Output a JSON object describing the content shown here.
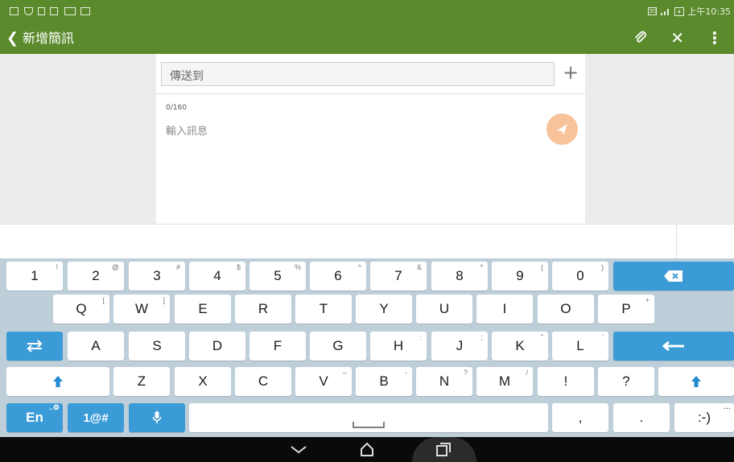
{
  "status_bar": {
    "time": "上午10:35",
    "network_badge": "3G",
    "signal_icon": "signal-bars-icon",
    "battery_icon": "battery-charging-icon",
    "left_icons": [
      "gallery-icon",
      "wifi-tray-icon",
      "document-icon",
      "file-edit-icon",
      "card-icon",
      "mail-icon"
    ]
  },
  "action_bar": {
    "back_glyph": "❮",
    "title": "新增簡訊",
    "attach_icon": "paperclip-icon",
    "discard_icon": "close-icon",
    "overflow_icon": "overflow-menu-icon",
    "attach_glyph": "🖇",
    "close_glyph": "✕",
    "more_glyph": "⋮"
  },
  "composer": {
    "to_placeholder": "傳送到",
    "add_glyph": "+",
    "char_counter": "0/160",
    "message_placeholder": "輸入訊息",
    "send_icon": "send-plane-icon",
    "send_color": "#f8c29a"
  },
  "keyboard": {
    "row1": [
      {
        "label": "1",
        "sub": "!"
      },
      {
        "label": "2",
        "sub": "@"
      },
      {
        "label": "3",
        "sub": "#"
      },
      {
        "label": "4",
        "sub": "$"
      },
      {
        "label": "5",
        "sub": "%"
      },
      {
        "label": "6",
        "sub": "^"
      },
      {
        "label": "7",
        "sub": "&"
      },
      {
        "label": "8",
        "sub": "*"
      },
      {
        "label": "9",
        "sub": "("
      },
      {
        "label": "0",
        "sub": ")"
      }
    ],
    "row2": [
      {
        "label": "Q",
        "sub": "["
      },
      {
        "label": "W",
        "sub": "]"
      },
      {
        "label": "E",
        "sub": ""
      },
      {
        "label": "R",
        "sub": ""
      },
      {
        "label": "T",
        "sub": ""
      },
      {
        "label": "Y",
        "sub": ""
      },
      {
        "label": "U",
        "sub": ""
      },
      {
        "label": "I",
        "sub": ""
      },
      {
        "label": "O",
        "sub": ""
      },
      {
        "label": "P",
        "sub": "+"
      }
    ],
    "row3": [
      {
        "label": "A",
        "sub": ""
      },
      {
        "label": "S",
        "sub": ""
      },
      {
        "label": "D",
        "sub": ""
      },
      {
        "label": "F",
        "sub": ""
      },
      {
        "label": "G",
        "sub": ""
      },
      {
        "label": "H",
        "sub": ":"
      },
      {
        "label": "J",
        "sub": ";"
      },
      {
        "label": "K",
        "sub": "\""
      },
      {
        "label": "L",
        "sub": "'"
      }
    ],
    "row4": [
      {
        "label": "Z",
        "sub": ""
      },
      {
        "label": "X",
        "sub": ""
      },
      {
        "label": "C",
        "sub": ""
      },
      {
        "label": "V",
        "sub": "–"
      },
      {
        "label": "B",
        "sub": "-"
      },
      {
        "label": "N",
        "sub": "?"
      },
      {
        "label": "M",
        "sub": "/"
      },
      {
        "label": "!",
        "sub": ""
      },
      {
        "label": "?",
        "sub": ""
      }
    ],
    "lang_label": "En",
    "lang_sub": "..⚙",
    "symbols_label": "1@#",
    "comma_label": ",",
    "period_label": ".",
    "smiley_label": ":-)",
    "smiley_sub": "...",
    "space_glyph": "⎵",
    "backspace_glyph": "⌫",
    "enter_glyph": "⟵",
    "shift_glyph": "⇧",
    "switch_glyph": "⇄",
    "mic_glyph": "🎙",
    "accent_color": "#3b9bd6"
  },
  "nav_bar": {
    "back_icon": "nav-back-chevron-icon",
    "home_icon": "nav-home-icon",
    "recents_icon": "nav-recents-icon",
    "back_glyph": "﹀",
    "home_glyph": "⌂",
    "recents_glyph": "❐"
  }
}
